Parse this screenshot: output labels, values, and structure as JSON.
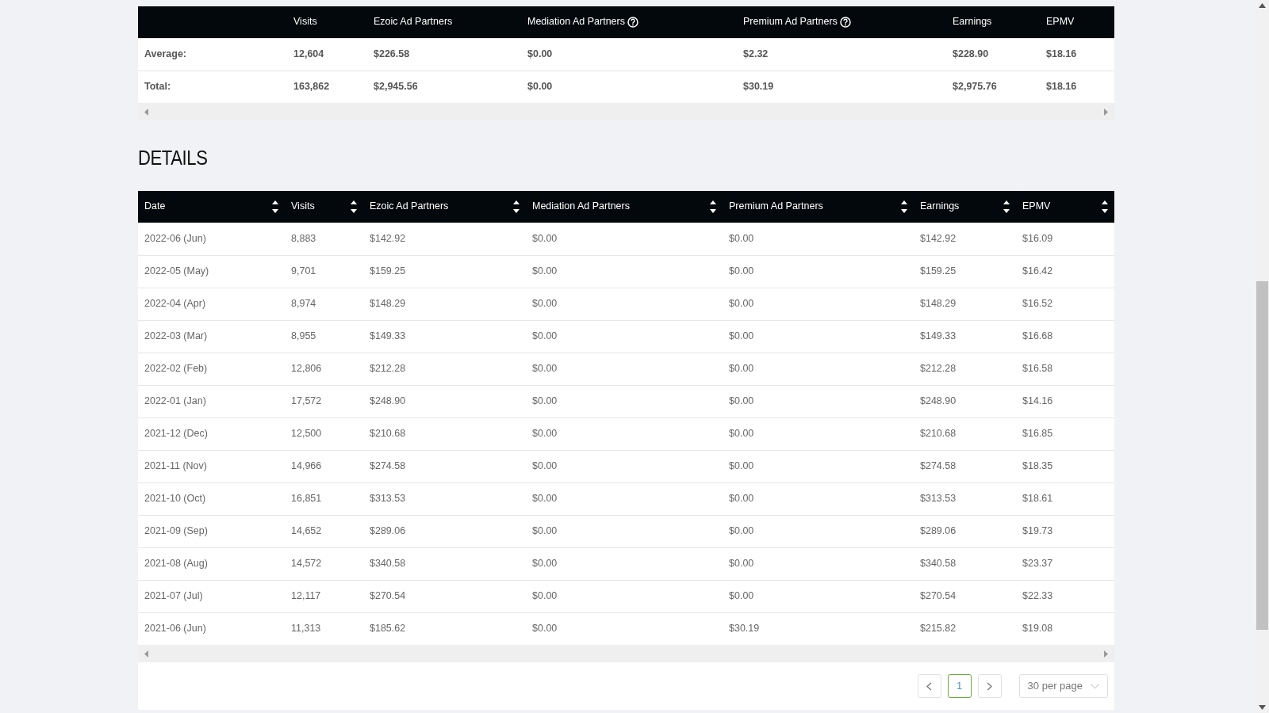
{
  "summary": {
    "columns": [
      {},
      {
        "label": "Visits"
      },
      {
        "label": "Ezoic Ad Partners"
      },
      {
        "label": "Mediation Ad Partners",
        "help": true
      },
      {
        "label": "Premium Ad Partners",
        "help": true
      },
      {
        "label": "Earnings"
      },
      {
        "label": "EPMV"
      }
    ],
    "rows": [
      [
        "Average:",
        "12,604",
        "$226.58",
        "$0.00",
        "$2.32",
        "$228.90",
        "$18.16"
      ],
      [
        "Total:",
        "163,862",
        "$2,945.56",
        "$0.00",
        "$30.19",
        "$2,975.76",
        "$18.16"
      ]
    ]
  },
  "details": {
    "title": "DETAILS",
    "columns": [
      {
        "label": "Date",
        "sortable": true
      },
      {
        "label": "Visits",
        "sortable": true
      },
      {
        "label": "Ezoic Ad Partners",
        "sortable": true
      },
      {
        "label": "Mediation Ad Partners",
        "sortable": true
      },
      {
        "label": "Premium Ad Partners",
        "sortable": true
      },
      {
        "label": "Earnings",
        "sortable": true
      },
      {
        "label": "EPMV",
        "sortable": true
      }
    ],
    "rows": [
      [
        "2022-06 (Jun)",
        "8,883",
        "$142.92",
        "$0.00",
        "$0.00",
        "$142.92",
        "$16.09"
      ],
      [
        "2022-05 (May)",
        "9,701",
        "$159.25",
        "$0.00",
        "$0.00",
        "$159.25",
        "$16.42"
      ],
      [
        "2022-04 (Apr)",
        "8,974",
        "$148.29",
        "$0.00",
        "$0.00",
        "$148.29",
        "$16.52"
      ],
      [
        "2022-03 (Mar)",
        "8,955",
        "$149.33",
        "$0.00",
        "$0.00",
        "$149.33",
        "$16.68"
      ],
      [
        "2022-02 (Feb)",
        "12,806",
        "$212.28",
        "$0.00",
        "$0.00",
        "$212.28",
        "$16.58"
      ],
      [
        "2022-01 (Jan)",
        "17,572",
        "$248.90",
        "$0.00",
        "$0.00",
        "$248.90",
        "$14.16"
      ],
      [
        "2021-12 (Dec)",
        "12,500",
        "$210.68",
        "$0.00",
        "$0.00",
        "$210.68",
        "$16.85"
      ],
      [
        "2021-11 (Nov)",
        "14,966",
        "$274.58",
        "$0.00",
        "$0.00",
        "$274.58",
        "$18.35"
      ],
      [
        "2021-10 (Oct)",
        "16,851",
        "$313.53",
        "$0.00",
        "$0.00",
        "$313.53",
        "$18.61"
      ],
      [
        "2021-09 (Sep)",
        "14,652",
        "$289.06",
        "$0.00",
        "$0.00",
        "$289.06",
        "$19.73"
      ],
      [
        "2021-08 (Aug)",
        "14,572",
        "$340.58",
        "$0.00",
        "$0.00",
        "$340.58",
        "$23.37"
      ],
      [
        "2021-07 (Jul)",
        "12,117",
        "$270.54",
        "$0.00",
        "$0.00",
        "$270.54",
        "$22.33"
      ],
      [
        "2021-06 (Jun)",
        "11,313",
        "$185.62",
        "$0.00",
        "$30.19",
        "$215.82",
        "$19.08"
      ]
    ],
    "pagination": {
      "pages": [
        {
          "label": "1",
          "selected": true
        }
      ],
      "per_page": "30 per page"
    }
  }
}
